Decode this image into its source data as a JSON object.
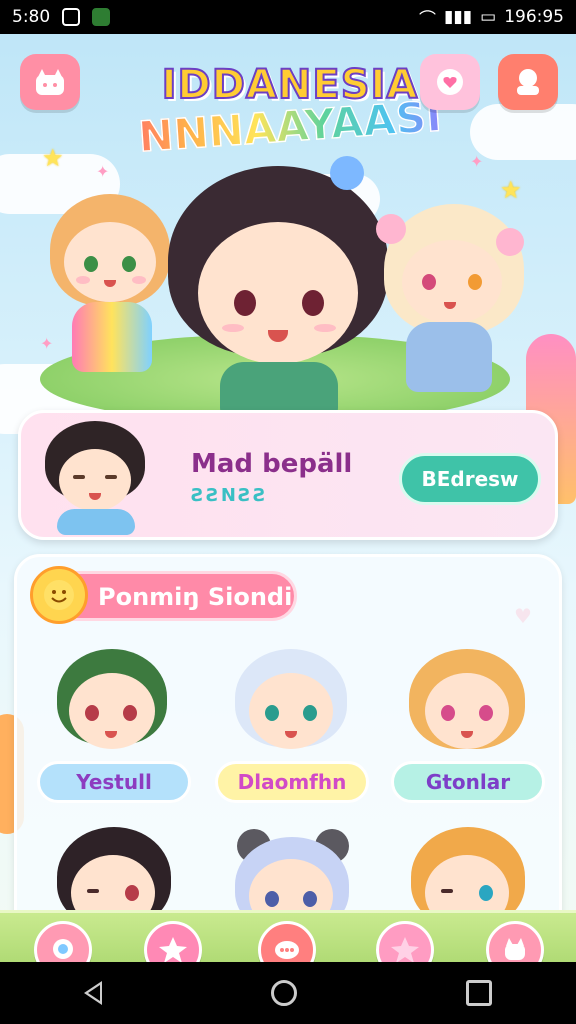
{
  "status_bar": {
    "time": "5:80",
    "right_text": "196:95",
    "icons": [
      "camera-icon",
      "gallery-icon",
      "wifi-icon",
      "signal-icon",
      "battery-icon"
    ]
  },
  "header": {
    "logo_line1": "IDDANESIA",
    "logo_line2": "NNNAAYAASI",
    "left_button_icon": "cat-face-icon",
    "mid_button_icon": "chat-heart-icon",
    "right_button_icon": "profile-bubble-icon"
  },
  "banner": {
    "title": "Mad bepäll",
    "subtitle": "ƧƧNƧƧ",
    "button_label": "BEdresw"
  },
  "section": {
    "title": "Ponmiŋ Siondi"
  },
  "characters": [
    {
      "name": "Yestull",
      "label_color": "#b4e1fb",
      "text_color": "#8d3cc0"
    },
    {
      "name": "Dlaomfhn",
      "label_color": "#fff3a6",
      "text_color": "#d14ac7"
    },
    {
      "name": "Gtonlar",
      "label_color": "#b6f1e5",
      "text_color": "#7d3ec8"
    },
    {
      "name": "",
      "label_color": "#ffffff",
      "text_color": "#000000"
    },
    {
      "name": "",
      "label_color": "#ffffff",
      "text_color": "#000000"
    },
    {
      "name": "",
      "label_color": "#ffffff",
      "text_color": "#000000"
    }
  ],
  "bottom_nav": [
    {
      "icon": "chat-bubble-icon",
      "color": "#ff9ab3"
    },
    {
      "icon": "star-icon",
      "color": "#ff89b5"
    },
    {
      "icon": "message-dots-icon",
      "color": "#ff7f7f"
    },
    {
      "icon": "star-filled-icon",
      "color": "#ff9cc2"
    },
    {
      "icon": "cat-icon",
      "color": "#ff9ab3"
    }
  ],
  "system_nav": [
    "back-icon",
    "home-icon",
    "recent-apps-icon"
  ],
  "colors": {
    "sky": "#bfe6f8",
    "grass": "#9fd063",
    "pink_accent": "#ff8aa8",
    "teal_button": "#3fc3a8"
  }
}
